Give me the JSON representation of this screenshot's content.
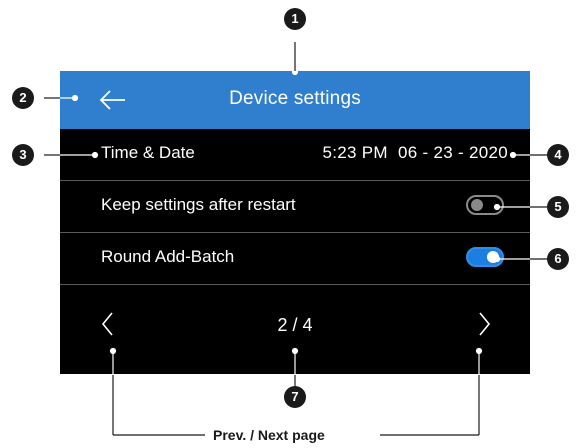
{
  "header": {
    "title": "Device settings",
    "back_icon": "arrow-left-icon"
  },
  "settings": [
    {
      "label": "Time & Date",
      "value": "5:23 PM  06 - 23 - 2020"
    },
    {
      "label": "Keep settings after restart",
      "toggle": "off"
    },
    {
      "label": "Round Add-Batch",
      "toggle": "on"
    }
  ],
  "pager": {
    "text": "2 / 4",
    "current": 2,
    "total": 4
  },
  "callouts": [
    "1",
    "2",
    "3",
    "4",
    "5",
    "6",
    "7"
  ],
  "footer_label": "Prev. / Next page",
  "colors": {
    "header": "#2f7fce",
    "screen": "#000000",
    "toggle_on": "#1c7fe0",
    "toggle_off": "#8a8a8a"
  }
}
